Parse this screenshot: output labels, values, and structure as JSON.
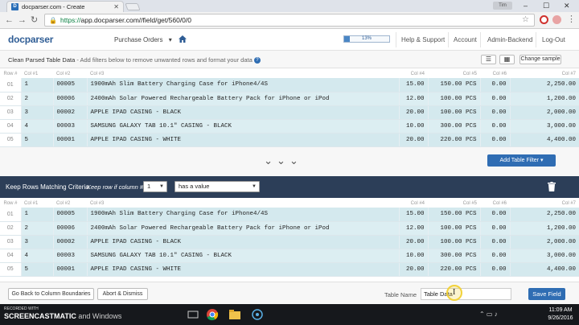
{
  "browser": {
    "tab_title": "docparser.com - Create",
    "tab_favicon": "D",
    "profile_label": "Tim",
    "url_scheme": "https://",
    "url_rest": "app.docparser.com//field/get/560/0/0"
  },
  "header": {
    "logo": "docparser",
    "nav_dropdown": "Purchase Orders",
    "progress_text": "13%",
    "progress_fraction": 0.13,
    "links": [
      "Help & Support",
      "Account",
      "Admin-Backend",
      "Log-Out"
    ]
  },
  "subheader": {
    "title": "Clean Parsed Table Data",
    "hint": " - Add filters below to remove unwanted rows and format your data",
    "change_sample": "Change sample"
  },
  "table": {
    "columns": [
      "Row #",
      "Col #1",
      "Col #2",
      "Col #3",
      "Col #4",
      "Col #5",
      "Col #6",
      "Col #7"
    ],
    "rows": [
      [
        "01",
        "1",
        "00005",
        "1900mAh Slim Battery Charging Case for iPhone4/4S",
        "15.00",
        "150.00 PCS",
        "0.00",
        "2,250.00"
      ],
      [
        "02",
        "2",
        "00006",
        "2400mAh Solar Powered Rechargeable Battery Pack for iPhone or iPod",
        "12.00",
        "100.00 PCS",
        "0.00",
        "1,200.00"
      ],
      [
        "03",
        "3",
        "00002",
        "APPLE IPAD CASING - BLACK",
        "20.00",
        "100.00 PCS",
        "0.00",
        "2,000.00"
      ],
      [
        "04",
        "4",
        "00003",
        "SAMSUNG GALAXY TAB 10.1\" CASING - BLACK",
        "10.00",
        "300.00 PCS",
        "0.00",
        "3,000.00"
      ],
      [
        "05",
        "5",
        "00001",
        "APPLE IPAD CASING - WHITE",
        "20.00",
        "220.00 PCS",
        "0.00",
        "4,400.00"
      ]
    ]
  },
  "actions": {
    "add_filter": "Add Table Filter ▾"
  },
  "filter": {
    "title": "Keep Rows Matching Criteria",
    "keep_label": "Keep row if column #",
    "column_value": "1",
    "condition_value": "has a value"
  },
  "footer": {
    "back_button": "Go Back to Column Boundaries",
    "abort_button": "Abort & Dismiss",
    "table_name_label": "Table Name",
    "table_name_value": "Table Data",
    "save_button": "Save Field"
  },
  "taskbar": {
    "recorder_line1": "RECORDED WITH",
    "recorder_brand": "SCREENCAST",
    "recorder_brand2": "MATIC",
    "recorder_suffix": " and Windows",
    "time": "11:09 AM",
    "date": "9/26/2016"
  },
  "colors": {
    "accent": "#2f6db3",
    "filter_bar": "#2c3e58",
    "row_bg": "#d4e9ee"
  }
}
